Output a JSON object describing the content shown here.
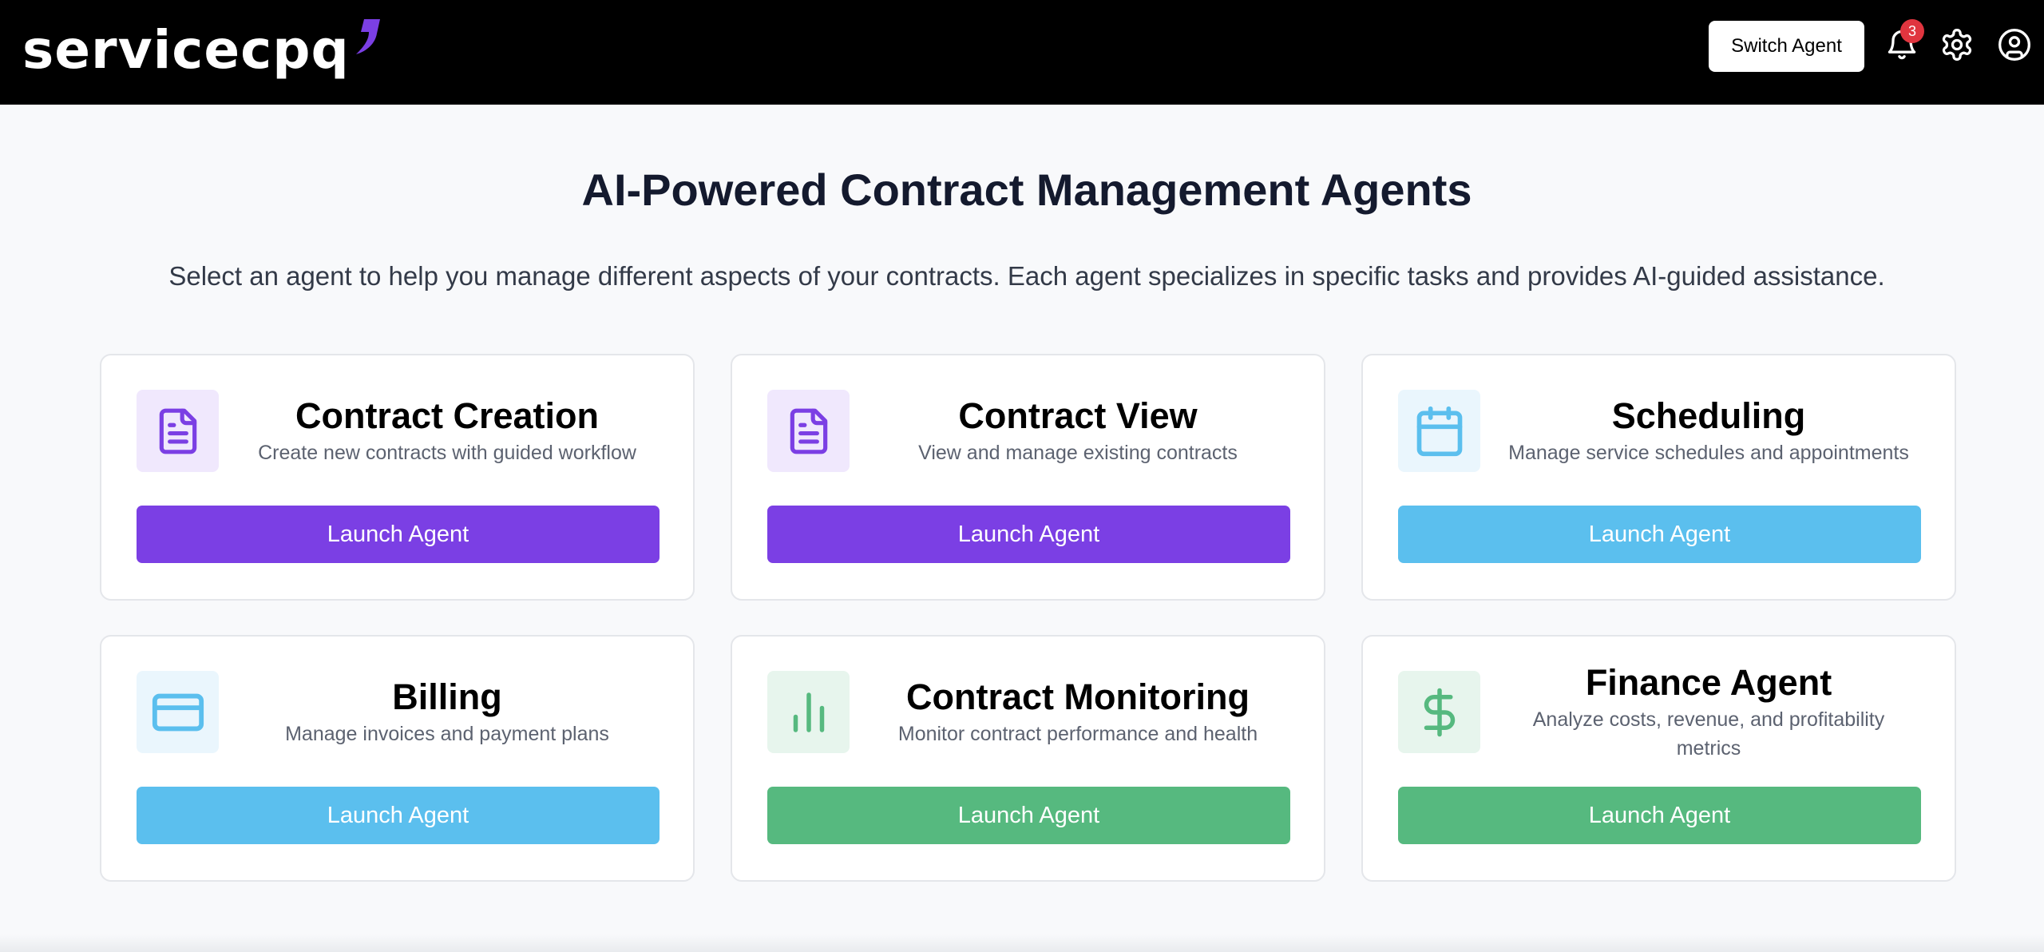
{
  "header": {
    "logo_text": "servicecpq",
    "switch_agent_label": "Switch Agent",
    "notification_count": "3",
    "accent_color": "#7b3fe4"
  },
  "main": {
    "title": "AI-Powered Contract Management Agents",
    "subtitle": "Select an agent to help you manage different aspects of your contracts. Each agent specializes in specific tasks and provides AI-guided assistance."
  },
  "agents": [
    {
      "title": "Contract Creation",
      "description": "Create new contracts with guided workflow",
      "button": "Launch Agent",
      "icon": "document-icon",
      "color": "#7b3fe4",
      "icon_bg": "#f0e8fd"
    },
    {
      "title": "Contract View",
      "description": "View and manage existing contracts",
      "button": "Launch Agent",
      "icon": "document-icon",
      "color": "#7b3fe4",
      "icon_bg": "#f0e8fd"
    },
    {
      "title": "Scheduling",
      "description": "Manage service schedules and appointments",
      "button": "Launch Agent",
      "icon": "calendar-icon",
      "color": "#5bbfee",
      "icon_bg": "#eaf6fd"
    },
    {
      "title": "Billing",
      "description": "Manage invoices and payment plans",
      "button": "Launch Agent",
      "icon": "credit-card-icon",
      "color": "#5bbfee",
      "icon_bg": "#eaf6fd"
    },
    {
      "title": "Contract Monitoring",
      "description": "Monitor contract performance and health",
      "button": "Launch Agent",
      "icon": "bar-chart-icon",
      "color": "#56b97f",
      "icon_bg": "#e7f5ed"
    },
    {
      "title": "Finance Agent",
      "description": "Analyze costs, revenue, and profitability metrics",
      "button": "Launch Agent",
      "icon": "dollar-icon",
      "color": "#56b97f",
      "icon_bg": "#e7f5ed"
    }
  ]
}
